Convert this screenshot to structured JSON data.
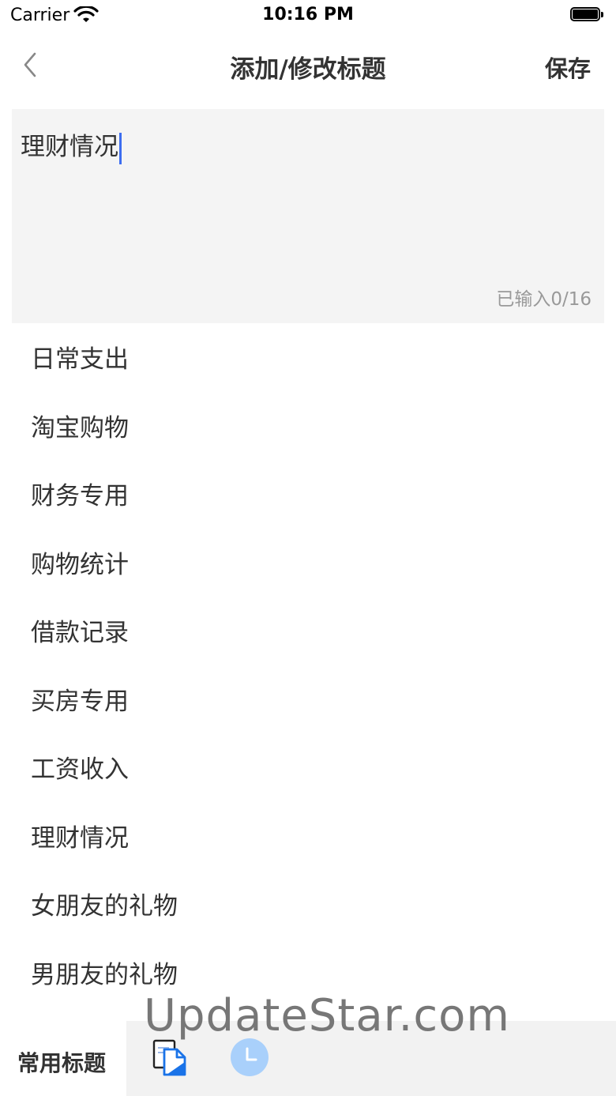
{
  "status_bar": {
    "carrier": "Carrier",
    "time": "10:16 PM"
  },
  "nav": {
    "title": "添加/修改标题",
    "save_label": "保存"
  },
  "editor": {
    "value": "理财情况",
    "counter": "已输入0/16"
  },
  "titles": [
    "日常支出",
    "淘宝购物",
    "财务专用",
    "购物统计",
    "借款记录",
    "买房专用",
    "工资收入",
    "理财情况",
    "女朋友的礼物",
    "男朋友的礼物"
  ],
  "watermark": "UpdateStar.com",
  "bottom_bar": {
    "label": "常用标题",
    "icons": [
      "document-icon",
      "clock-icon"
    ]
  },
  "colors": {
    "accent": "#3d6df0",
    "clock_icon": "#a9d0fb",
    "doc_icon": "#1a73e8"
  }
}
